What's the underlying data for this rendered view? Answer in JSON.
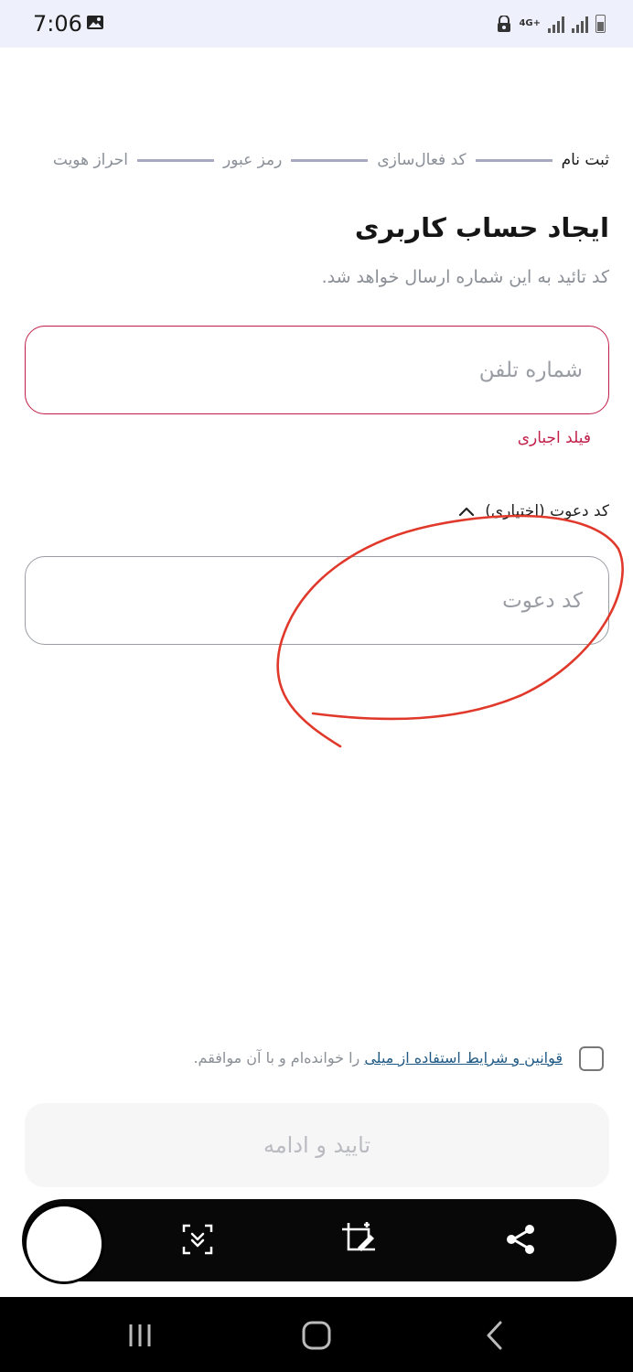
{
  "status_bar": {
    "time": "7:06",
    "network": "4G+",
    "icons": [
      "gallery-icon",
      "vpn-icon",
      "signal-icon",
      "signal-icon",
      "battery-icon"
    ]
  },
  "stepper": {
    "steps": [
      "ثبت نام",
      "کد فعال‌سازی",
      "رمز عبور",
      "احراز هویت"
    ],
    "active_index": 0
  },
  "page": {
    "title": "ایجاد حساب کاربری",
    "subtitle": "کد تائید به این شماره ارسال خواهد شد."
  },
  "phone": {
    "placeholder": "شماره تلفن",
    "value": "",
    "error": "فیلد اجباری",
    "error_color": "#c0204a"
  },
  "invite": {
    "toggle_label": "کد دعوت (اختیاری)",
    "placeholder": "کد دعوت",
    "value": ""
  },
  "terms": {
    "checked": false,
    "link_text": "قوانین و شرایط استفاده از میلی",
    "suffix_text": " را خوانده‌ام و با آن موافقم."
  },
  "confirm_button": {
    "label": "تایید و ادامه",
    "enabled": false
  },
  "screenshot_toolbar": {
    "icons": [
      "scroll-capture-icon",
      "crop-edit-icon",
      "share-icon"
    ]
  },
  "nav_bar": {
    "icons": [
      "recents-icon",
      "home-icon",
      "back-icon"
    ]
  },
  "colors": {
    "error": "#c0204a",
    "annotation": "#e0392b",
    "link": "#1f5a86"
  }
}
